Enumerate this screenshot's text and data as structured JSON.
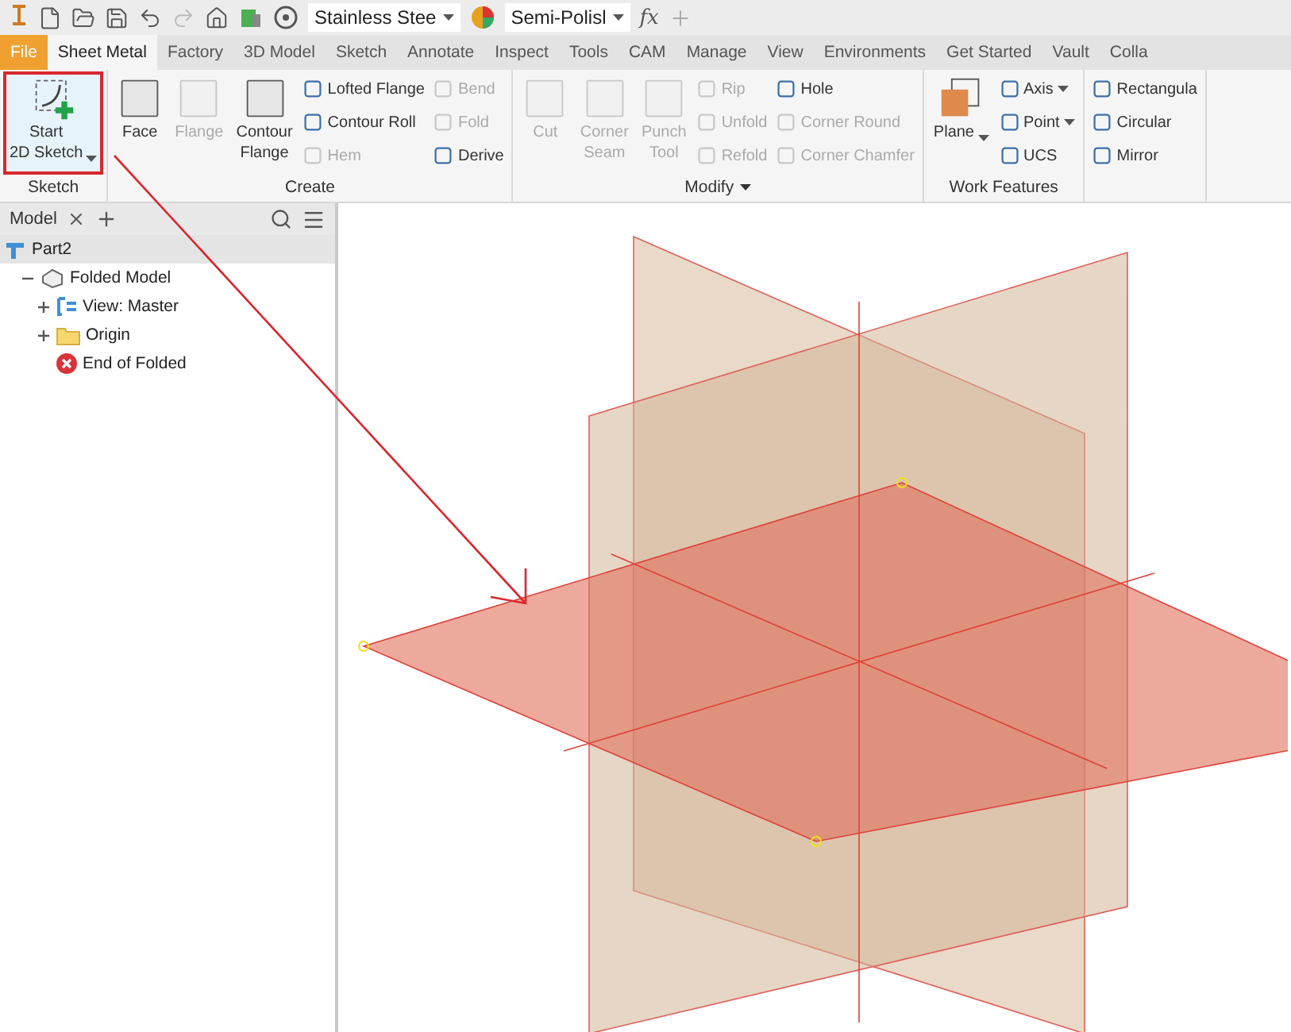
{
  "quick_access": {
    "material": "Stainless Stee",
    "appearance": "Semi-Polisl",
    "formula": "fx"
  },
  "tabs": [
    {
      "label": "File",
      "kind": "file",
      "selected": false
    },
    {
      "label": "Sheet Metal",
      "kind": "tab",
      "selected": true
    },
    {
      "label": "Factory",
      "kind": "tab",
      "selected": false
    },
    {
      "label": "3D Model",
      "kind": "tab",
      "selected": false
    },
    {
      "label": "Sketch",
      "kind": "tab",
      "selected": false
    },
    {
      "label": "Annotate",
      "kind": "tab",
      "selected": false
    },
    {
      "label": "Inspect",
      "kind": "tab",
      "selected": false
    },
    {
      "label": "Tools",
      "kind": "tab",
      "selected": false
    },
    {
      "label": "CAM",
      "kind": "tab",
      "selected": false
    },
    {
      "label": "Manage",
      "kind": "tab",
      "selected": false
    },
    {
      "label": "View",
      "kind": "tab",
      "selected": false
    },
    {
      "label": "Environments",
      "kind": "tab",
      "selected": false
    },
    {
      "label": "Get Started",
      "kind": "tab",
      "selected": false
    },
    {
      "label": "Vault",
      "kind": "tab",
      "selected": false
    },
    {
      "label": "Colla",
      "kind": "tab",
      "selected": false
    }
  ],
  "ribbon": [
    {
      "title": "Sketch",
      "items": [
        {
          "kind": "large",
          "label": "Start\n2D Sketch",
          "disabled": false,
          "dropdown": true,
          "highlighted": true
        }
      ]
    },
    {
      "title": "Create",
      "items": [
        {
          "kind": "large",
          "label": "Face",
          "disabled": false,
          "dropdown": false,
          "highlighted": false
        },
        {
          "kind": "large",
          "label": "Flange",
          "disabled": true,
          "dropdown": false,
          "highlighted": false
        },
        {
          "kind": "large",
          "label": "Contour\nFlange",
          "disabled": false,
          "dropdown": false,
          "highlighted": false
        },
        {
          "kind": "stack",
          "items": [
            {
              "label": "Lofted Flange",
              "disabled": false,
              "dropdown": false
            },
            {
              "label": "Contour Roll",
              "disabled": false,
              "dropdown": false
            },
            {
              "label": "Hem",
              "disabled": true,
              "dropdown": false
            }
          ]
        },
        {
          "kind": "stack",
          "items": [
            {
              "label": "Bend",
              "disabled": true,
              "dropdown": false
            },
            {
              "label": "Fold",
              "disabled": true,
              "dropdown": false
            },
            {
              "label": "Derive",
              "disabled": false,
              "dropdown": false
            }
          ]
        }
      ]
    },
    {
      "title": "Modify",
      "dropdown": true,
      "items": [
        {
          "kind": "large",
          "label": "Cut",
          "disabled": true,
          "dropdown": false,
          "highlighted": false
        },
        {
          "kind": "large",
          "label": "Corner\nSeam",
          "disabled": true,
          "dropdown": false,
          "highlighted": false
        },
        {
          "kind": "large",
          "label": "Punch\nTool",
          "disabled": true,
          "dropdown": false,
          "highlighted": false
        },
        {
          "kind": "stack",
          "items": [
            {
              "label": "Rip",
              "disabled": true,
              "dropdown": false
            },
            {
              "label": "Unfold",
              "disabled": true,
              "dropdown": false
            },
            {
              "label": "Refold",
              "disabled": true,
              "dropdown": false
            }
          ]
        },
        {
          "kind": "stack",
          "items": [
            {
              "label": "Hole",
              "disabled": false,
              "dropdown": false
            },
            {
              "label": "Corner Round",
              "disabled": true,
              "dropdown": false
            },
            {
              "label": "Corner Chamfer",
              "disabled": true,
              "dropdown": false
            }
          ]
        }
      ]
    },
    {
      "title": "Work Features",
      "items": [
        {
          "kind": "large",
          "label": "Plane",
          "disabled": false,
          "dropdown": true,
          "highlighted": false
        },
        {
          "kind": "stack",
          "items": [
            {
              "label": "Axis",
              "disabled": false,
              "dropdown": true
            },
            {
              "label": "Point",
              "disabled": false,
              "dropdown": true
            },
            {
              "label": "UCS",
              "disabled": false,
              "dropdown": false
            }
          ]
        }
      ]
    },
    {
      "items": [
        {
          "kind": "stack",
          "items": [
            {
              "label": "Rectangula",
              "disabled": false,
              "dropdown": false
            },
            {
              "label": "Circular",
              "disabled": false,
              "dropdown": false
            },
            {
              "label": "Mirror",
              "disabled": false,
              "dropdown": false
            }
          ]
        }
      ]
    }
  ],
  "browser": {
    "tab": "Model",
    "tree": [
      {
        "label": "Part2",
        "kind": "part",
        "selected": true,
        "children": [
          {
            "label": "Folded Model",
            "kind": "body",
            "selected": false,
            "expanded": true,
            "children": [
              {
                "label": "View: Master",
                "kind": "view",
                "selected": false,
                "expanded": false
              },
              {
                "label": "Origin",
                "kind": "folder",
                "selected": false,
                "expanded": false
              },
              {
                "label": "End of Folded",
                "kind": "end",
                "selected": false
              }
            ]
          }
        ]
      }
    ]
  }
}
